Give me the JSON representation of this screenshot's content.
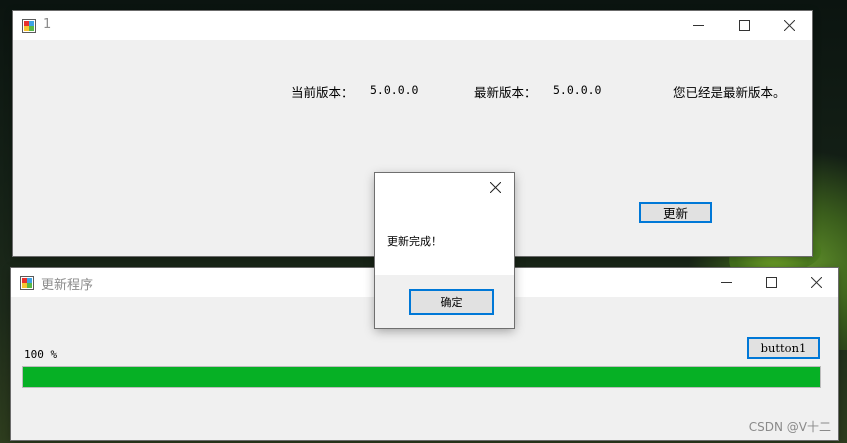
{
  "window1": {
    "title": "1",
    "current_version_label": "当前版本：",
    "current_version_value": "5.0.0.0",
    "latest_version_label": "最新版本：",
    "latest_version_value": "5.0.0.0",
    "status_text": "您已经是最新版本。",
    "update_button": "更新"
  },
  "window2": {
    "title": "更新程序",
    "progress_text": "100 %",
    "progress_value": 1.0,
    "button1": "button1"
  },
  "messagebox": {
    "text": "更新完成！",
    "ok_button": "确定"
  },
  "watermark": "CSDN @V十二",
  "colors": {
    "progress_fill": "#06b025",
    "focus_border": "#0078d7"
  }
}
